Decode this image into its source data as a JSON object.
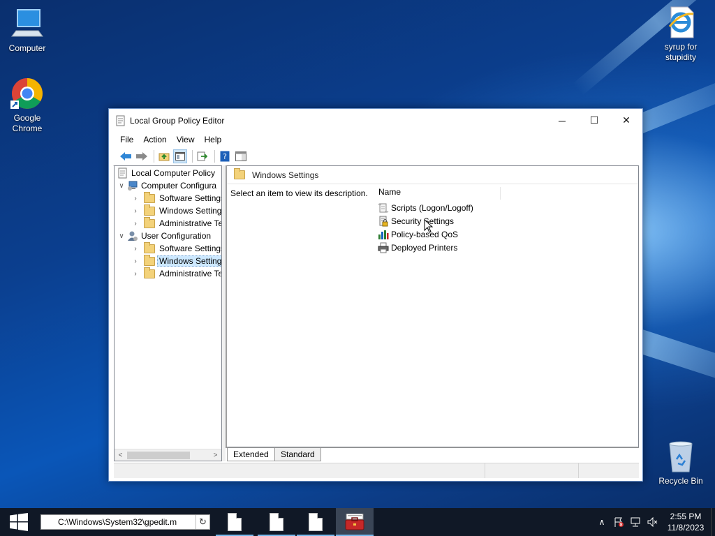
{
  "desktop": {
    "icons": [
      {
        "label_line1": "Computer",
        "label_line2": ""
      },
      {
        "label_line1": "Google",
        "label_line2": "Chrome"
      },
      {
        "label_line1": "syrup for",
        "label_line2": "stupidity"
      },
      {
        "label_line1": "Recycle Bin",
        "label_line2": ""
      }
    ]
  },
  "window": {
    "title": "Local Group Policy Editor",
    "controls": {
      "minimize": "─",
      "maximize": "☐",
      "close": "✕"
    },
    "menu": [
      "File",
      "Action",
      "View",
      "Help"
    ],
    "tree": {
      "root": "Local Computer Policy",
      "items": [
        {
          "label": "Computer Configura",
          "chevron": "∨"
        },
        {
          "label": "Software Settings",
          "chevron": "›"
        },
        {
          "label": "Windows Setting",
          "chevron": "›"
        },
        {
          "label": "Administrative Te",
          "chevron": "›"
        },
        {
          "label": "User Configuration",
          "chevron": "∨"
        },
        {
          "label": "Software Settings",
          "chevron": "›"
        },
        {
          "label": "Windows Setting",
          "chevron": "›"
        },
        {
          "label": "Administrative Te",
          "chevron": "›"
        }
      ],
      "scroll_left": "<",
      "scroll_right": ">"
    },
    "content": {
      "header": "Windows Settings",
      "description": "Select an item to view its description.",
      "column_name": "Name",
      "items": [
        "Scripts (Logon/Logoff)",
        "Security Settings",
        "Policy-based QoS",
        "Deployed Printers"
      ]
    },
    "tabs": [
      "Extended",
      "Standard"
    ]
  },
  "taskbar": {
    "address": "C:\\Windows\\System32\\gpedit.m",
    "clock_time": "2:55 PM",
    "clock_date": "11/8/2023",
    "tray_chevron": "∧"
  }
}
